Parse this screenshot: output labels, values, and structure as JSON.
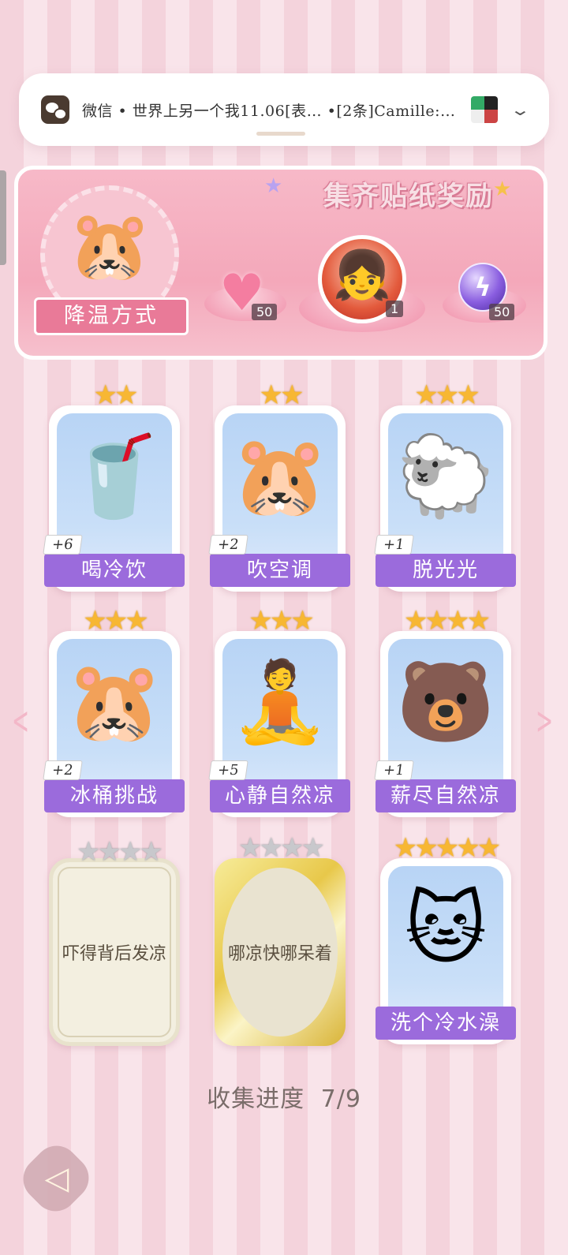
{
  "notification": {
    "text": "微信 • 世界上另一个我11.06[表… •[2条]Camille:…",
    "app": "wechat-icon"
  },
  "banner": {
    "title": "集齐贴纸奖励",
    "cool_label": "降温方式",
    "rewards": [
      {
        "name": "heart-gem",
        "count": "50"
      },
      {
        "name": "character-avatar",
        "count": "1"
      },
      {
        "name": "purple-orb",
        "count": "50"
      }
    ]
  },
  "cards": [
    {
      "label": "喝冷饮",
      "badge": "+6",
      "stars": 2,
      "art": "🥤"
    },
    {
      "label": "吹空调",
      "badge": "+2",
      "stars": 2,
      "art": "🐹"
    },
    {
      "label": "脱光光",
      "badge": "+1",
      "stars": 3,
      "art": "🐑"
    },
    {
      "label": "冰桶挑战",
      "badge": "+2",
      "stars": 3,
      "art": "🐹"
    },
    {
      "label": "心静自然凉",
      "badge": "+5",
      "stars": 3,
      "art": "🧘"
    },
    {
      "label": "薪尽自然凉",
      "badge": "+1",
      "stars": 4,
      "art": "🐻"
    },
    {
      "label": "吓得背后发凉",
      "stars": 4,
      "locked": true
    },
    {
      "label": "哪凉快哪呆着",
      "stars": 4,
      "locked": true
    },
    {
      "label": "洗个冷水澡",
      "stars": 5,
      "art": "🐱"
    }
  ],
  "progress": {
    "label": "收集进度",
    "value": "7/9"
  },
  "colors": {
    "accent": "#9b6bdc",
    "pink": "#e97a98",
    "star": "#f7b733"
  }
}
